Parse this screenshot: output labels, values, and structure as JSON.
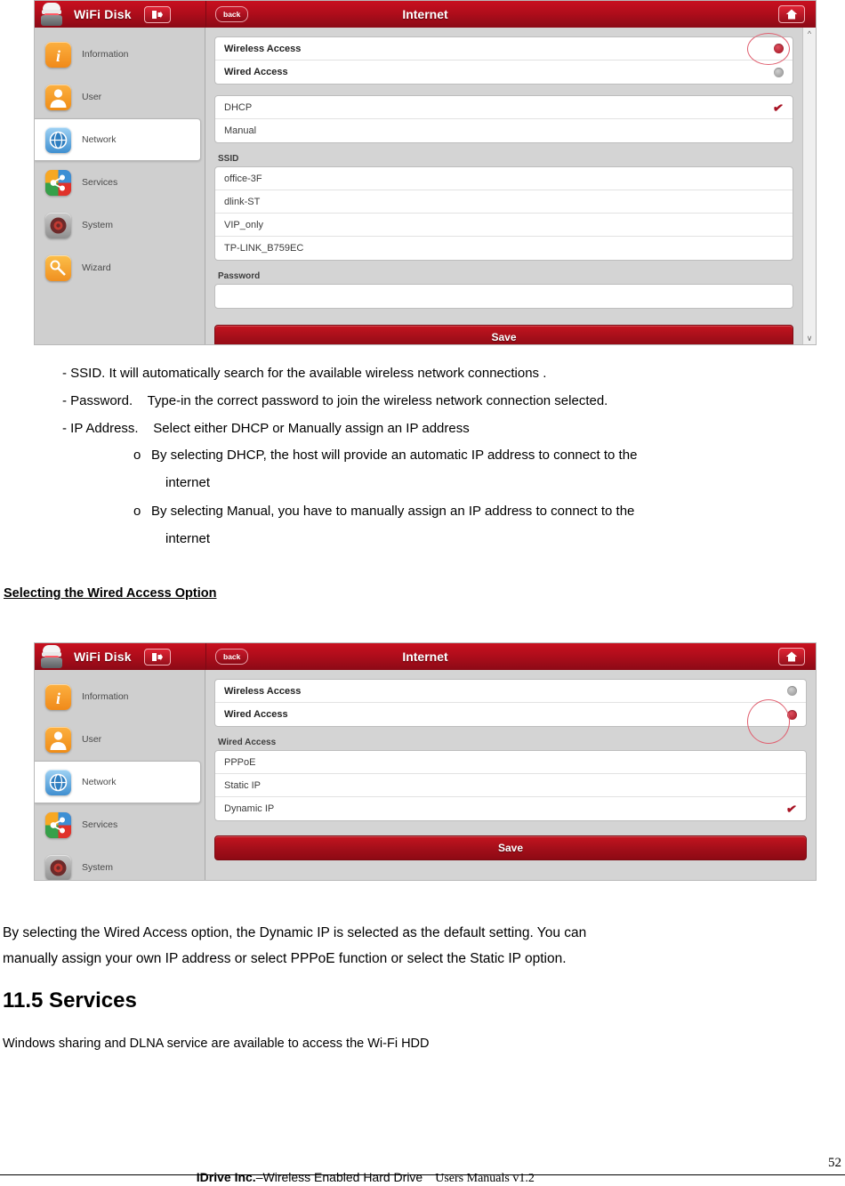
{
  "colors": {
    "header_red_top": "#c8101f",
    "header_red_bottom": "#8b0a16",
    "accent_check": "#a81424",
    "radio_on": "#9c0f1c",
    "annotation_ellipse": "#e06070",
    "panel_gray": "#d4d4d4"
  },
  "panel_one": {
    "brand": "WiFi Disk",
    "back_label": "back",
    "title": "Internet",
    "sidebar": [
      {
        "label": "Information",
        "icon": "info-icon",
        "active": false
      },
      {
        "label": "User",
        "icon": "user-icon",
        "active": false
      },
      {
        "label": "Network",
        "icon": "globe-icon",
        "active": true
      },
      {
        "label": "Services",
        "icon": "share-icon",
        "active": false
      },
      {
        "label": "System",
        "icon": "gear-icon",
        "active": false
      },
      {
        "label": "Wizard",
        "icon": "wand-icon",
        "active": false
      }
    ],
    "access_rows": [
      {
        "label": "Wireless Access",
        "state": "selected"
      },
      {
        "label": "Wired Access",
        "state": "unselected"
      }
    ],
    "ip_rows": [
      {
        "label": "DHCP",
        "state": "checked"
      },
      {
        "label": "Manual",
        "state": "unchecked"
      }
    ],
    "ssid_label": "SSID",
    "ssid_rows": [
      {
        "label": "office-3F"
      },
      {
        "label": "dlink-ST"
      },
      {
        "label": "VIP_only"
      },
      {
        "label": "TP-LINK_B759EC"
      }
    ],
    "password_label": "Password",
    "password_value": "",
    "save_label": "Save"
  },
  "panel_two": {
    "brand": "WiFi Disk",
    "back_label": "back",
    "title": "Internet",
    "sidebar": [
      {
        "label": "Information",
        "icon": "info-icon",
        "active": false
      },
      {
        "label": "User",
        "icon": "user-icon",
        "active": false
      },
      {
        "label": "Network",
        "icon": "globe-icon",
        "active": true
      },
      {
        "label": "Services",
        "icon": "share-icon",
        "active": false
      },
      {
        "label": "System",
        "icon": "gear-icon",
        "active": false
      }
    ],
    "access_rows": [
      {
        "label": "Wireless Access",
        "state": "unselected"
      },
      {
        "label": "Wired Access",
        "state": "selected"
      }
    ],
    "wired_label": "Wired Access",
    "wired_rows": [
      {
        "label": "PPPoE",
        "state": "unchecked"
      },
      {
        "label": "Static IP",
        "state": "unchecked"
      },
      {
        "label": "Dynamic IP",
        "state": "checked"
      }
    ],
    "save_label": "Save"
  },
  "body_text": {
    "bullets": [
      "- SSID. It will automatically search for the available wireless network connections .",
      "- Password.    Type-in the correct password to join the wireless network connection selected.",
      "- IP Address.    Select either DHCP or Manually assign an IP address"
    ],
    "sub_bullets": [
      {
        "marker": "o",
        "line1": "By selecting DHCP, the host will provide an automatic IP address to connect to the",
        "line2": "internet"
      },
      {
        "marker": "o",
        "line1": "By selecting Manual, you have to manually assign an IP address to connect to the",
        "line2": "internet"
      }
    ],
    "wired_heading": "Selecting the Wired Access Option",
    "para_line1": "By selecting the Wired Access option, the Dynamic IP is selected as the default setting.      You can",
    "para_line2": "manually assign your own IP address or select   PPPoE function or select the Static IP option.",
    "services_heading": "11.5 Services",
    "services_text": "Windows sharing and DLNA service are available to access the Wi-Fi HDD"
  },
  "footer": {
    "company": "IDrive Inc.",
    "product": "–Wireless Enabled Hard Drive",
    "manual": "Users Manuals v1.2",
    "page_number": "52"
  }
}
